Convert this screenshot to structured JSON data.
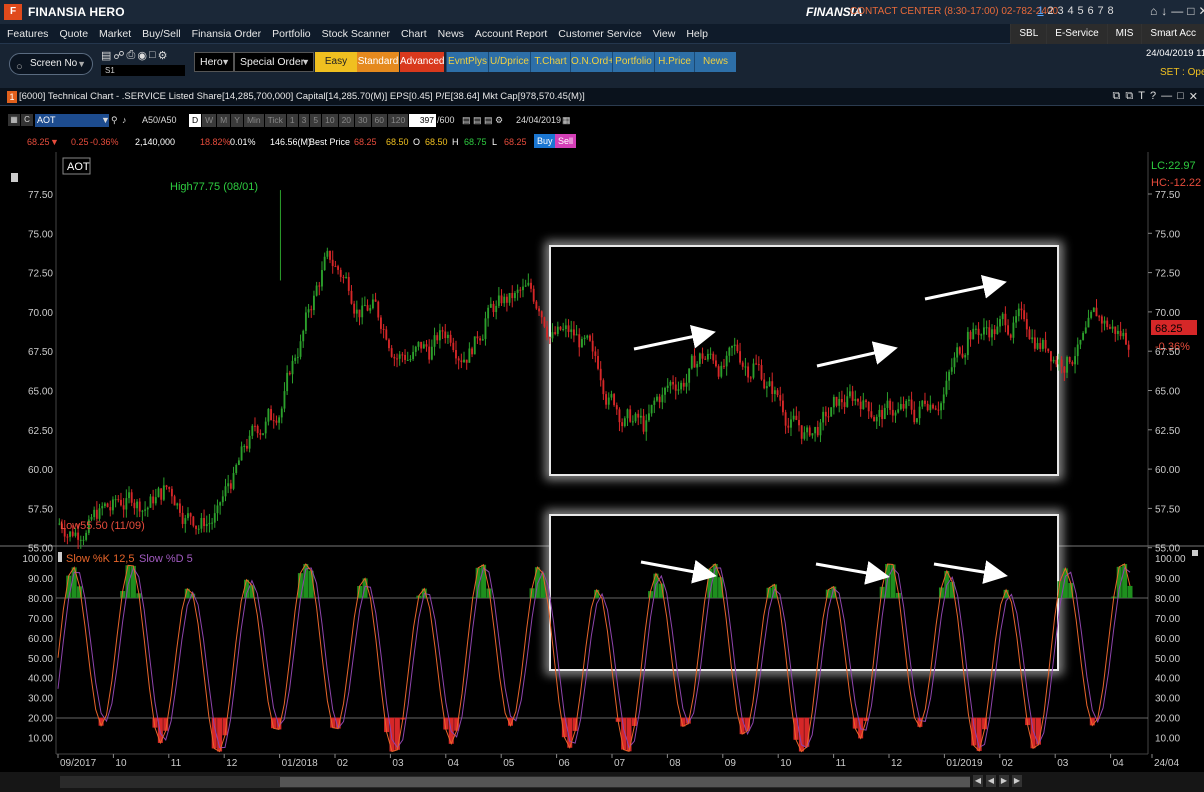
{
  "titlebar": {
    "logo": "F",
    "app_title": "FINANSIA  HERO",
    "brand": "FINANSIA",
    "contact": "CONTACT CENTER (8:30-17:00) 02-782-2400",
    "pages": [
      "1",
      "2",
      "3",
      "4",
      "5",
      "6",
      "7",
      "8"
    ],
    "active_page": "1",
    "window_icons": [
      "⌂",
      "↓",
      "—",
      "□",
      "✕"
    ]
  },
  "menu": {
    "items": [
      "Features",
      "Quote",
      "Market",
      "Buy/Sell",
      "Finansia Order",
      "Portfolio",
      "Stock Scanner",
      "Chart",
      "News",
      "Account Report",
      "Customer Service",
      "View",
      "Help"
    ],
    "right_buttons": [
      "SBL",
      "E-Service",
      "MIS",
      "Smart Acc"
    ]
  },
  "toolbar": {
    "screen_no": "Screen No",
    "s1_label": "S1",
    "hero_select": "Hero",
    "order_select": "Special Order",
    "buttons": [
      "Easy",
      "Standard",
      "Advanced",
      "EvntPlys",
      "U/Dprice",
      "T.Chart",
      "O.N.Ord+",
      "Portfolio",
      "H.Price",
      "News"
    ],
    "date": "24/04/2019 11:",
    "set_label": "SET : Ope"
  },
  "window": {
    "number": "1",
    "title": "[6000] Technical Chart - .SERVICE Listed Share[14,285,700,000] Capital[14,285.70(M)] EPS[0.45] P/E[38.64] Mkt Cap[978,570.45(M)]",
    "controls": [
      "⧉",
      "⧉",
      "T",
      "?",
      "—",
      "□",
      "✕"
    ]
  },
  "chart_toolbar": {
    "symbol": "AOT",
    "ticker_label": "A50/A50",
    "periods": [
      "D",
      "W",
      "M",
      "Y",
      "Min",
      "Tick",
      "1",
      "3",
      "5",
      "10",
      "20",
      "30",
      "60",
      "120"
    ],
    "active_period": "D",
    "bars": "397",
    "bars_total": "/600",
    "date": "24/04/2019"
  },
  "quote": {
    "last": "68.25",
    "change": "0.25",
    "pct": "-0.36%",
    "volume": "2,140,000",
    "pct2": "18.82%",
    "pct3": "0.01%",
    "value": "146.56(M)",
    "best_price_label": "Best Price",
    "best_price": "68.25",
    "bid": "68.50",
    "o_label": "O",
    "open": "68.50",
    "h_label": "H",
    "high": "68.75",
    "l_label": "L",
    "low": "68.25",
    "buy": "Buy",
    "sell": "Sell"
  },
  "chart": {
    "symbol_label": "AOT",
    "high_annotation": "High77.75 (08/01)",
    "low_annotation": "Low55.50 (11/09)",
    "lc_label": "LC:22.97",
    "hc_label": "HC:-12.22",
    "last_price_tag": "68.25",
    "last_change_tag": "-0.36%",
    "price_axis": [
      "77.50",
      "75.00",
      "72.50",
      "70.00",
      "67.50",
      "65.00",
      "62.50",
      "60.00",
      "57.50",
      "55.00"
    ],
    "stoch_legend_k": "Slow %K 12,5",
    "stoch_legend_d": "Slow %D 5",
    "stoch_axis": [
      "100.00",
      "90.00",
      "80.00",
      "70.00",
      "60.00",
      "50.00",
      "40.00",
      "30.00",
      "20.00",
      "10.00"
    ],
    "time_axis": [
      "09/2017",
      "10",
      "11",
      "12",
      "01/2018",
      "02",
      "03",
      "04",
      "05",
      "06",
      "07",
      "08",
      "09",
      "10",
      "11",
      "12",
      "01/2019",
      "02",
      "03",
      "04",
      "24/04"
    ],
    "colors": {
      "up": "#2ca02c",
      "down": "#d62728",
      "k_line": "#e8652a",
      "d_line": "#8e44ad"
    }
  },
  "chart_data": {
    "type": "candlestick",
    "title": "AOT",
    "ylim": [
      54.0,
      79.0
    ],
    "close_series_monthly": [
      {
        "x": "09/2017",
        "y": 57.5
      },
      {
        "x": "10",
        "y": 58.5
      },
      {
        "x": "11",
        "y": 57.0
      },
      {
        "x": "12",
        "y": 63.5
      },
      {
        "x": "01/2018",
        "y": 73.0
      },
      {
        "x": "02",
        "y": 70.0
      },
      {
        "x": "03",
        "y": 67.5
      },
      {
        "x": "04",
        "y": 69.5
      },
      {
        "x": "05",
        "y": 70.5
      },
      {
        "x": "06",
        "y": 67.0
      },
      {
        "x": "07",
        "y": 62.5
      },
      {
        "x": "08",
        "y": 67.0
      },
      {
        "x": "09",
        "y": 66.5
      },
      {
        "x": "10",
        "y": 62.0
      },
      {
        "x": "11",
        "y": 64.5
      },
      {
        "x": "12",
        "y": 63.5
      },
      {
        "x": "01/2019",
        "y": 68.5
      },
      {
        "x": "02",
        "y": 69.5
      },
      {
        "x": "03",
        "y": 67.5
      },
      {
        "x": "04",
        "y": 68.25
      }
    ],
    "high": {
      "value": 77.75,
      "date": "08/01"
    },
    "low": {
      "value": 55.5,
      "date": "11/09"
    },
    "stochastic": {
      "k_params": "12,5",
      "d_params": "5",
      "ylim": [
        0,
        100
      ],
      "levels": [
        80,
        20
      ]
    }
  }
}
